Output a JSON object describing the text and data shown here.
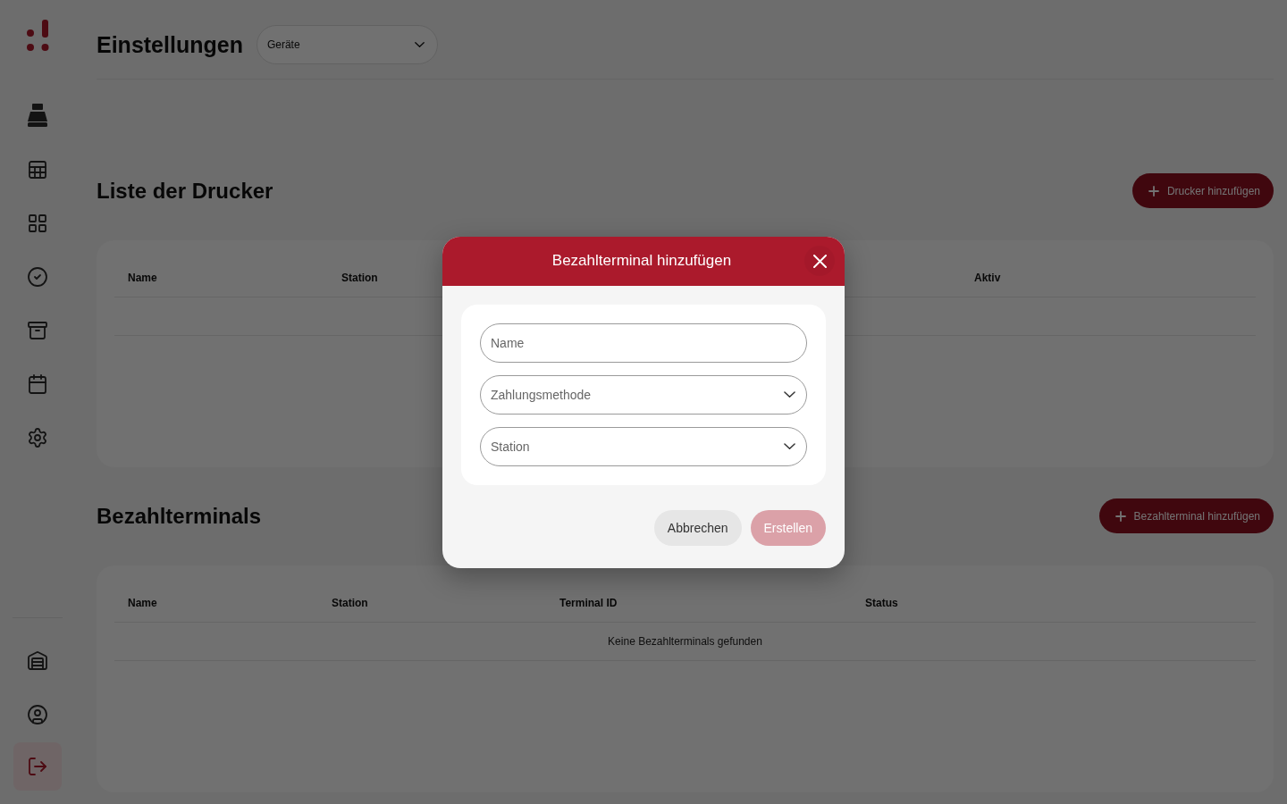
{
  "header": {
    "title": "Einstellungen",
    "select": {
      "value": "Geräte"
    }
  },
  "sections": [
    {
      "title": "Liste der Drucker",
      "add_button": "Drucker hinzufügen",
      "table": {
        "columns": [
          "Name",
          "Station",
          "Aktiv"
        ]
      }
    },
    {
      "title": "Bezahlterminals",
      "add_button": "Bezahlterminal hinzufügen",
      "table": {
        "columns": [
          "Name",
          "Station",
          "Terminal ID",
          "Status"
        ],
        "empty_message": "Keine Bezahlterminals gefunden"
      }
    }
  ],
  "dialog": {
    "title": "Bezahlterminal hinzufügen",
    "fields": [
      {
        "kind": "text",
        "placeholder": "Name"
      },
      {
        "kind": "select",
        "placeholder": "Zahlungsmethode"
      },
      {
        "kind": "select",
        "placeholder": "Station"
      }
    ],
    "buttons": [
      {
        "kind": "secondary",
        "label": "Abbrechen",
        "disabled": false
      },
      {
        "kind": "primary",
        "label": "Erstellen",
        "disabled": true
      }
    ]
  }
}
